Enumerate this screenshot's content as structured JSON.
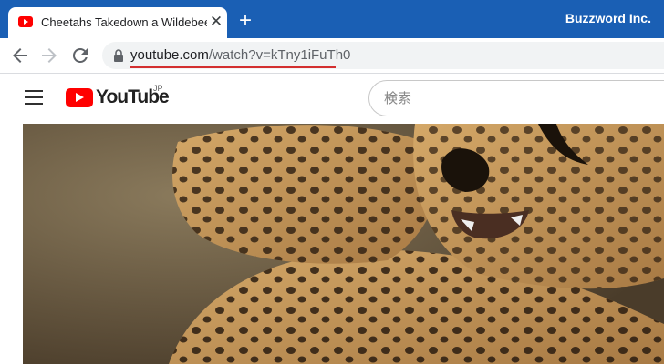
{
  "browser": {
    "tab": {
      "title": "Cheetahs Takedown a Wildebeest",
      "close_glyph": "✕"
    },
    "new_tab_glyph": "+",
    "profile_name": "Buzzword Inc.",
    "address_bar": {
      "host": "youtube.com",
      "path": "/watch?v=kTny1iFuTh0"
    }
  },
  "youtube": {
    "logo_text": "YouTube",
    "country_code": "JP",
    "search_placeholder": "検索"
  },
  "video": {
    "subject": "cheetah-frame"
  },
  "colors": {
    "titlebar": "#1a5fb4",
    "youtube_red": "#ff0000",
    "url_underline": "#d32f2f"
  }
}
